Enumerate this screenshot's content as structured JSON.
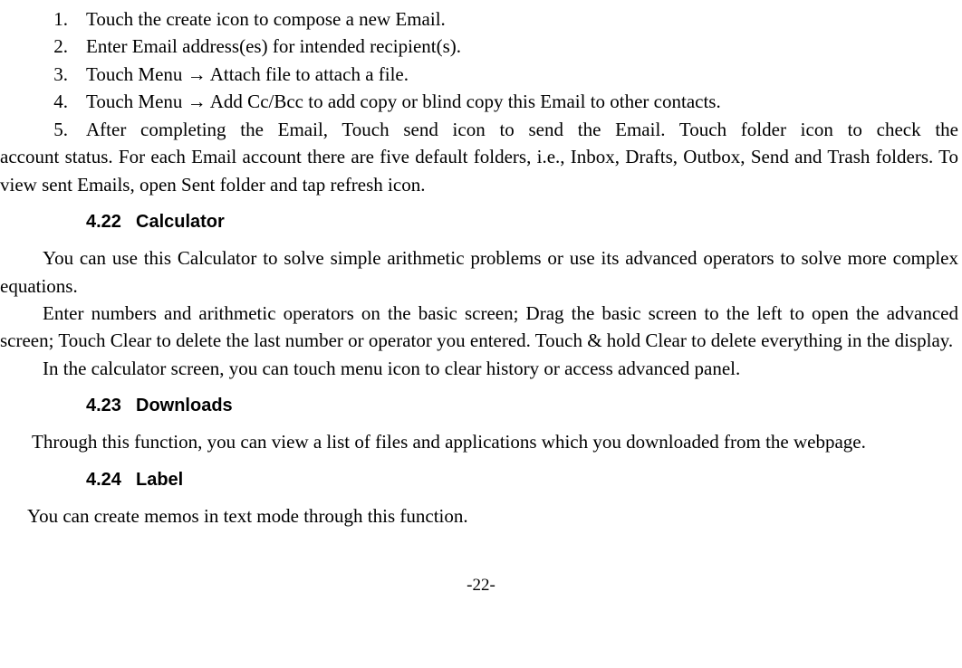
{
  "list": [
    {
      "num": "1.",
      "text": "Touch the create icon to compose a new Email."
    },
    {
      "num": "2.",
      "text": "Enter Email address(es) for intended recipient(s)."
    },
    {
      "num": "3.",
      "text": "Touch Menu → Attach file to attach a file."
    },
    {
      "num": "4.",
      "text": "Touch Menu → Add Cc/Bcc to add copy or blind copy this Email to other contacts."
    },
    {
      "num": "5.",
      "text_line": "After completing the Email, Touch send icon to send the Email. Touch folder icon to check the"
    }
  ],
  "list_cont": "account status. For each Email account there are five default folders, i.e., Inbox, Drafts, Outbox, Send and Trash folders. To view sent Emails, open Sent folder and tap refresh icon.",
  "sections": {
    "s1": {
      "num": "4.22",
      "title": "Calculator"
    },
    "s2": {
      "num": "4.23",
      "title": "Downloads"
    },
    "s3": {
      "num": "4.24",
      "title": "Label"
    }
  },
  "calc": {
    "p1": "You can use this Calculator to solve simple arithmetic problems or use its advanced operators to solve more complex equations.",
    "p2": "Enter numbers and arithmetic operators on the basic screen; Drag the basic screen to the left to open the advanced screen; Touch Clear to delete the last number or operator you entered. Touch & hold Clear to delete everything in the display.",
    "p3": "In the calculator screen, you can touch menu icon to clear history or access advanced panel."
  },
  "downloads": {
    "p1": "Through this function, you can view a list of files and applications which you downloaded from the webpage."
  },
  "label": {
    "p1": "You can create memos in text mode through this function."
  },
  "footer": "-22-"
}
